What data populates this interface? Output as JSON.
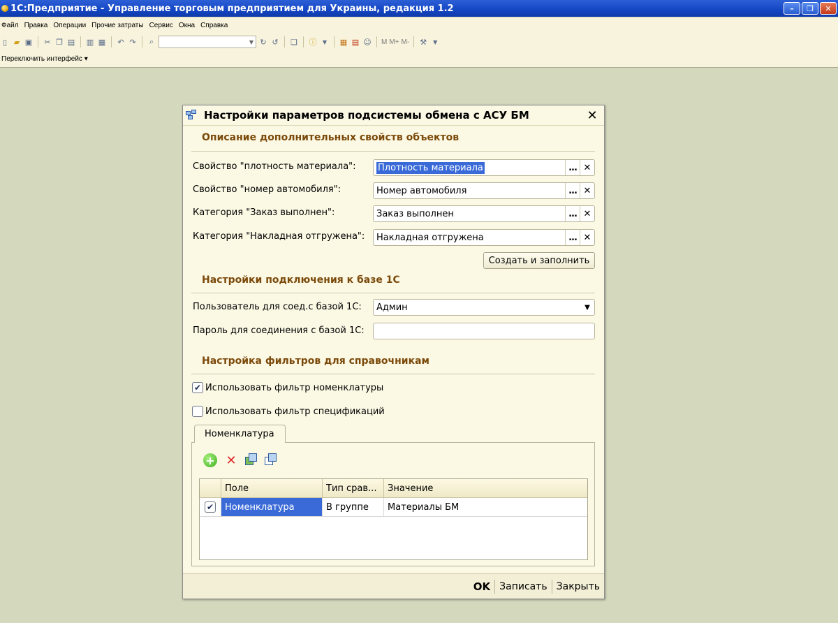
{
  "window": {
    "title": "1С:Предприятие - Управление торговым предприятием для Украины, редакция 1.2"
  },
  "menu": {
    "items": [
      "Файл",
      "Правка",
      "Операции",
      "Прочие затраты",
      "Сервис",
      "Окна",
      "Справка"
    ]
  },
  "toolbar": {
    "memory_labels": [
      "M",
      "M+",
      "M-"
    ]
  },
  "switch_interface": {
    "label": "Переключить интерфейс ▾"
  },
  "dialog": {
    "title": "Настройки параметров подсистемы обмена с АСУ БМ",
    "section1": {
      "title": "Описание дополнительных свойств объектов",
      "rows": [
        {
          "label": "Свойство \"плотность материала\":",
          "value": "Плотность материала",
          "selected": true
        },
        {
          "label": "Свойство \"номер автомобиля\":",
          "value": "Номер автомобиля"
        },
        {
          "label": "Категория \"Заказ выполнен\":",
          "value": "Заказ выполнен"
        },
        {
          "label": "Категория \"Накладная отгружена\":",
          "value": "Накладная отгружена"
        }
      ],
      "dots_glyph": "...",
      "clear_glyph": "✕",
      "create_button": "Создать и заполнить"
    },
    "section2": {
      "title": "Настройки подключения к базе 1С",
      "user_label": "Пользователь для соед.с базой 1С:",
      "user_value": "Админ",
      "password_label": "Пароль для соединения с базой 1С:",
      "password_value": ""
    },
    "section3": {
      "title": "Настройка фильтров для справочникам",
      "checkbox1_label": "Использовать фильтр номенклатуры",
      "checkbox1_checked": true,
      "checkbox2_label": "Использовать фильтр спецификаций",
      "checkbox2_checked": false
    },
    "tab": {
      "label": "Номенклатура"
    },
    "grid": {
      "columns": [
        "Поле",
        "Тип срав...",
        "Значение"
      ],
      "rows": [
        {
          "checked": true,
          "field": "Номенклатура",
          "compare": "В группе",
          "value": "Материалы БМ"
        }
      ]
    },
    "footer": {
      "ok": "OK",
      "save": "Записать",
      "close": "Закрыть"
    }
  }
}
